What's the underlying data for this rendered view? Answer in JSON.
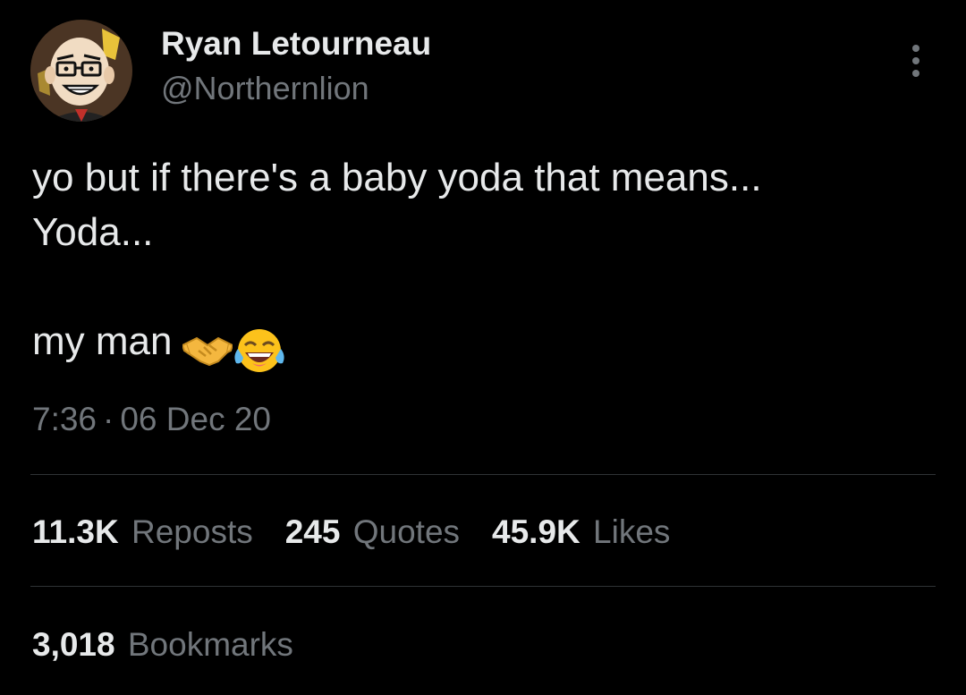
{
  "author": {
    "name": "Ryan Letourneau",
    "handle": "@Northernlion"
  },
  "tweet": {
    "line1": "yo but if there's a baby yoda that means...",
    "line2": "Yoda...",
    "line3": "my man",
    "emojis": [
      "handshake-emoji",
      "tears-of-joy-emoji"
    ]
  },
  "meta": {
    "time": "7:36",
    "separator": "·",
    "date": "06 Dec 20"
  },
  "stats": {
    "reposts": {
      "count": "11.3K",
      "label": "Reposts"
    },
    "quotes": {
      "count": "245",
      "label": "Quotes"
    },
    "likes": {
      "count": "45.9K",
      "label": "Likes"
    },
    "bookmarks": {
      "count": "3,018",
      "label": "Bookmarks"
    }
  },
  "colors": {
    "background": "#000000",
    "primary_text": "#e7e9ea",
    "secondary_text": "#71767b",
    "divider": "#2f3336"
  },
  "icons": {
    "more": "more-options-icon"
  }
}
